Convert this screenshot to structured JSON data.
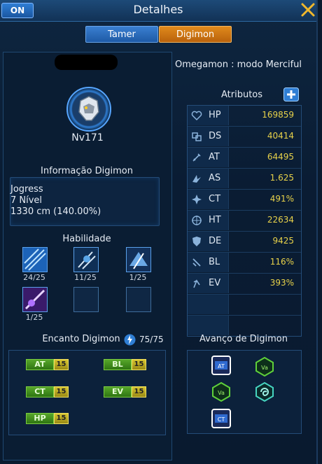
{
  "window": {
    "title": "Detalhes",
    "on_label": "ON"
  },
  "tabs": [
    {
      "label": "Tamer",
      "active": false
    },
    {
      "label": "Digimon",
      "active": true
    }
  ],
  "digimon": {
    "name": "Omegamon : modo Merciful",
    "level": "Nv171"
  },
  "info": {
    "heading": "Informação Digimon",
    "lines": [
      "Jogress",
      "7 Nível",
      "1330 cm (140.00%)"
    ]
  },
  "skills": {
    "heading": "Habilidade",
    "items": [
      {
        "level": "24/25"
      },
      {
        "level": "11/25"
      },
      {
        "level": "1/25"
      },
      {
        "level": "1/25"
      }
    ]
  },
  "encanto": {
    "heading": "Encanto Digimon",
    "value": "75/75",
    "items": [
      {
        "label": "AT",
        "value": "15"
      },
      {
        "label": "BL",
        "value": "15"
      },
      {
        "label": "CT",
        "value": "15"
      },
      {
        "label": "EV",
        "value": "15"
      },
      {
        "label": "HP",
        "value": "15"
      }
    ]
  },
  "atributos": {
    "heading": "Atributos",
    "rows": [
      {
        "key": "HP",
        "value": "169859",
        "icon": "heart-icon"
      },
      {
        "key": "DS",
        "value": "40414",
        "icon": "ds-icon"
      },
      {
        "key": "AT",
        "value": "64495",
        "icon": "sword-icon"
      },
      {
        "key": "AS",
        "value": "1.625",
        "icon": "speed-icon"
      },
      {
        "key": "CT",
        "value": "491%",
        "icon": "critical-icon"
      },
      {
        "key": "HT",
        "value": "22634",
        "icon": "target-icon"
      },
      {
        "key": "DE",
        "value": "9425",
        "icon": "shield-icon"
      },
      {
        "key": "BL",
        "value": "116%",
        "icon": "block-icon"
      },
      {
        "key": "EV",
        "value": "393%",
        "icon": "evade-icon"
      }
    ]
  },
  "avanco": {
    "heading": "Avanço de Digimon"
  },
  "colors": {
    "accent_blue": "#2f7ed4",
    "tab_active": "#e08a1c",
    "value_yellow": "#e8d24a",
    "badge_green": "#56a62a"
  }
}
